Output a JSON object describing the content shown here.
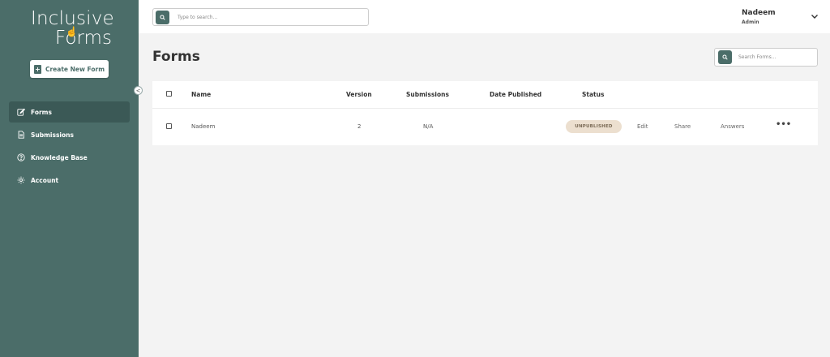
{
  "brand": {
    "line1": "Inclusive",
    "line2": "Forms",
    "cursor": "☝"
  },
  "sidebar": {
    "create_label": "Create New Form",
    "items": [
      {
        "label": "Forms",
        "icon": "edit-icon",
        "active": true
      },
      {
        "label": "Submissions",
        "icon": "document-icon",
        "active": false
      },
      {
        "label": "Knowledge Base",
        "icon": "help-circle-icon",
        "active": false
      },
      {
        "label": "Account",
        "icon": "gear-icon",
        "active": false
      }
    ],
    "collapse_glyph": "<"
  },
  "header": {
    "search_placeholder": "Type to search...",
    "user_name": "Nadeem",
    "user_role": "Admin"
  },
  "main": {
    "title": "Forms",
    "search_placeholder": "Search Forms...",
    "columns": [
      "Name",
      "Version",
      "Submissions",
      "Date Published",
      "Status"
    ],
    "rows": [
      {
        "name": "Nadeem",
        "version": "2",
        "submissions": "N/A",
        "date_published": "",
        "status": "UNPUBLISHED",
        "actions": [
          "Edit",
          "Share",
          "Answers"
        ],
        "more": "•••"
      }
    ]
  },
  "colors": {
    "sidebar_bg": "#4b6d69",
    "sidebar_active": "#3b5956",
    "accent": "#4b6d69",
    "badge_bg": "#ecdfcf",
    "page_bg": "#f3f3f3"
  }
}
